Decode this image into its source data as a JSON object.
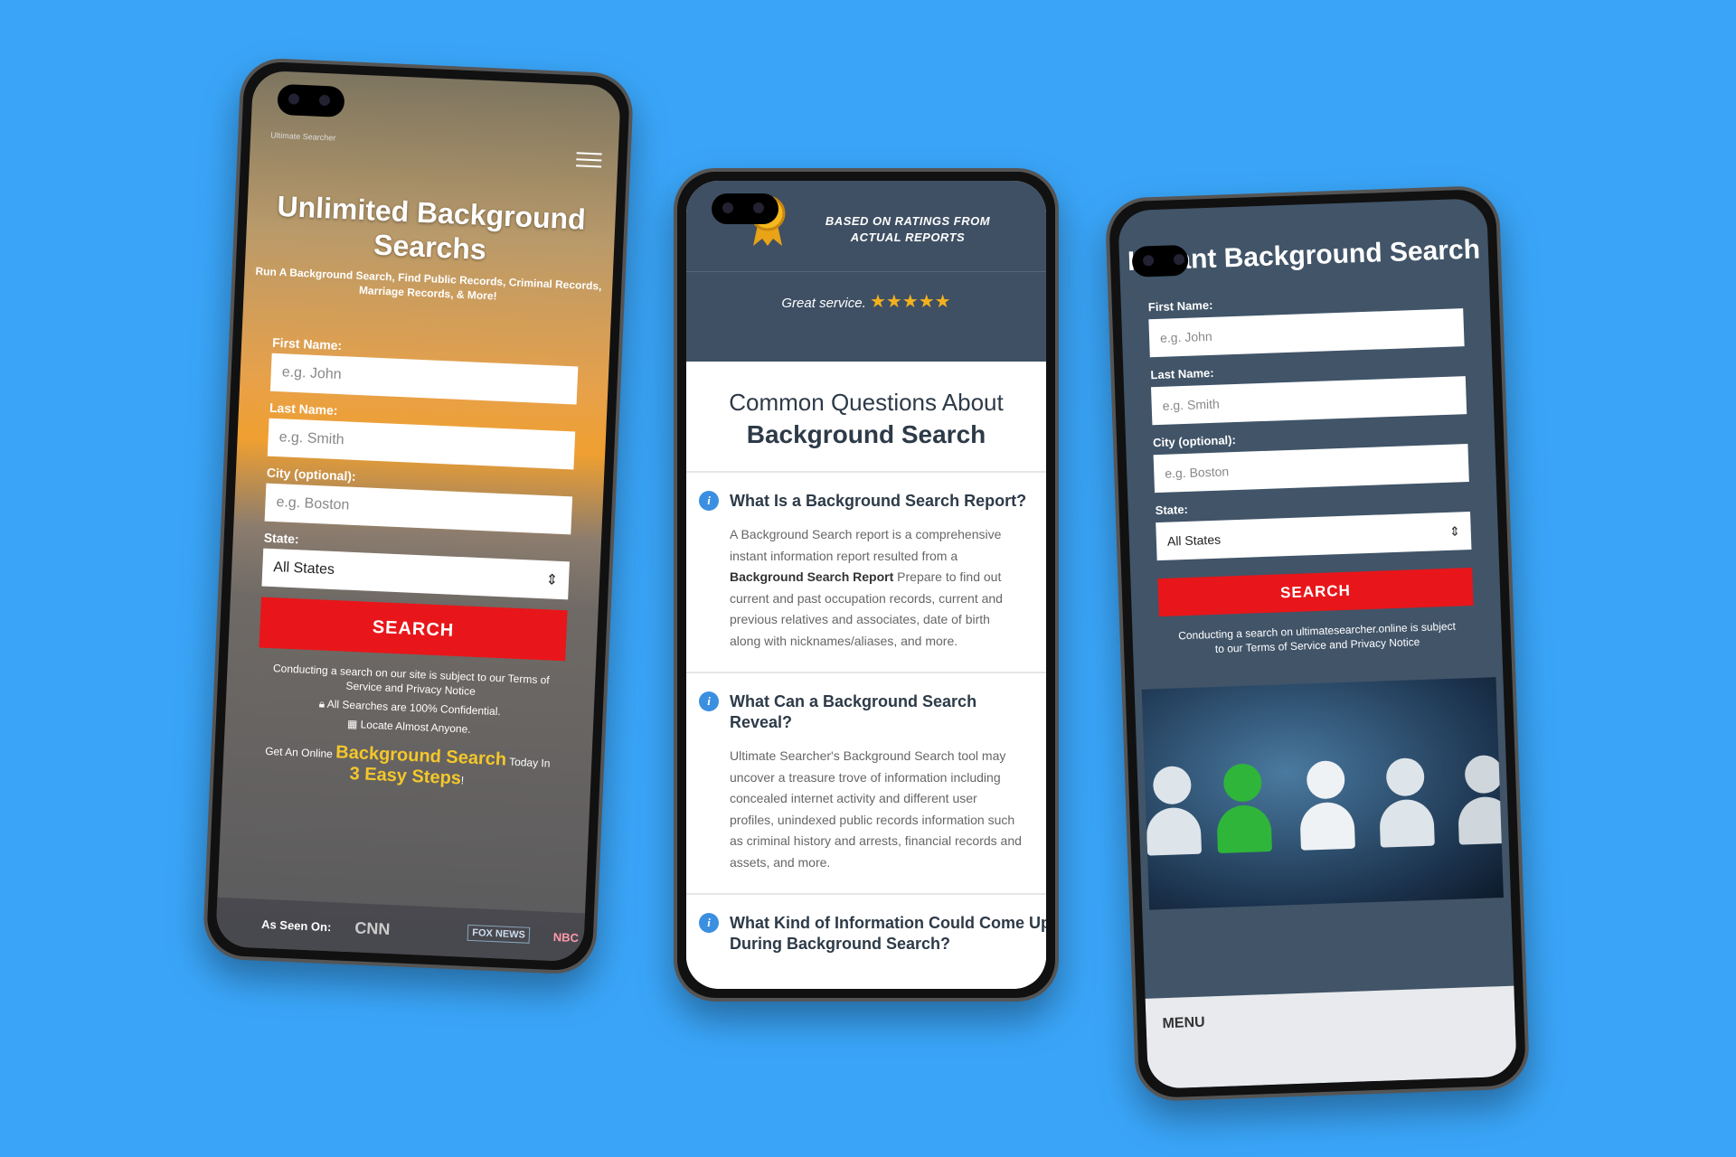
{
  "phone1": {
    "logo_text": "Ultimate Searcher",
    "title": "Unlimited Background Searchs",
    "subtitle": "Run A Background Search, Find Public Records, Criminal Records, Marriage Records, & More!",
    "fields": [
      {
        "label": "First Name:",
        "placeholder": "e.g. John"
      },
      {
        "label": "Last Name:",
        "placeholder": "e.g. Smith"
      },
      {
        "label": "City (optional):",
        "placeholder": "e.g. Boston"
      }
    ],
    "state_label": "State:",
    "state_value": "All States",
    "search_label": "SEARCH",
    "notice": "Conducting a search on our site is subject to our Terms of Service and Privacy Notice",
    "features": [
      "All Searches are 100% Confidential.",
      "Locate Almost Anyone."
    ],
    "promo_pre": "Get An Online",
    "promo_hl": "Background Search",
    "promo_mid": "Today In",
    "promo_hl2": "3 Easy Steps",
    "promo_end": "!",
    "seen_on_label": "As Seen On:",
    "seen_on_logos": [
      "CNN",
      "FOX NEWS",
      "NBC"
    ]
  },
  "phone2": {
    "rating_text": "BASED ON RATINGS FROM ACTUAL REPORTS",
    "review": "Great service.",
    "stars": "★★★★★",
    "heading_a": "Common Questions About",
    "heading_b": "Background Search",
    "faqs": [
      {
        "q": "What Is a Background Search Report?",
        "a1": "A Background Search report is a comprehensive",
        "a2": "instant information report resulted from a",
        "a3b": "Background Search Report",
        "a3": " Prepare to find out",
        "a4": "current and past occupation records, current and",
        "a5": "previous relatives and associates, date of birth",
        "a6": "along with nicknames/aliases, and more."
      },
      {
        "q": "What Can a Background Search Reveal?",
        "a1": "Ultimate Searcher's Background Search tool may",
        "a2": "uncover a treasure trove of information including",
        "a3": "concealed internet activity and different user",
        "a4": "profiles, unindexed public records information such",
        "a5": "as criminal history and arrests, financial records and",
        "a6": "assets, and more."
      },
      {
        "q": "What Kind of Information Could Come Up During Background Search?"
      }
    ]
  },
  "phone3": {
    "title": "Instant Background Search",
    "fields": [
      {
        "label": "First Name:",
        "placeholder": "e.g. John"
      },
      {
        "label": "Last Name:",
        "placeholder": "e.g. Smith"
      },
      {
        "label": "City (optional):",
        "placeholder": "e.g. Boston"
      }
    ],
    "state_label": "State:",
    "state_value": "All States",
    "search_label": "SEARCH",
    "notice": "Conducting a search on ultimatesearcher.online is subject to our Terms of Service and Privacy Notice",
    "menu_label": "MENU"
  },
  "colors": {
    "background": "#3aa5f8",
    "search_button": "#e8161a",
    "dark_panel": "#415468",
    "highlight": "#f4c72a",
    "info_icon": "#3a8fe0"
  }
}
